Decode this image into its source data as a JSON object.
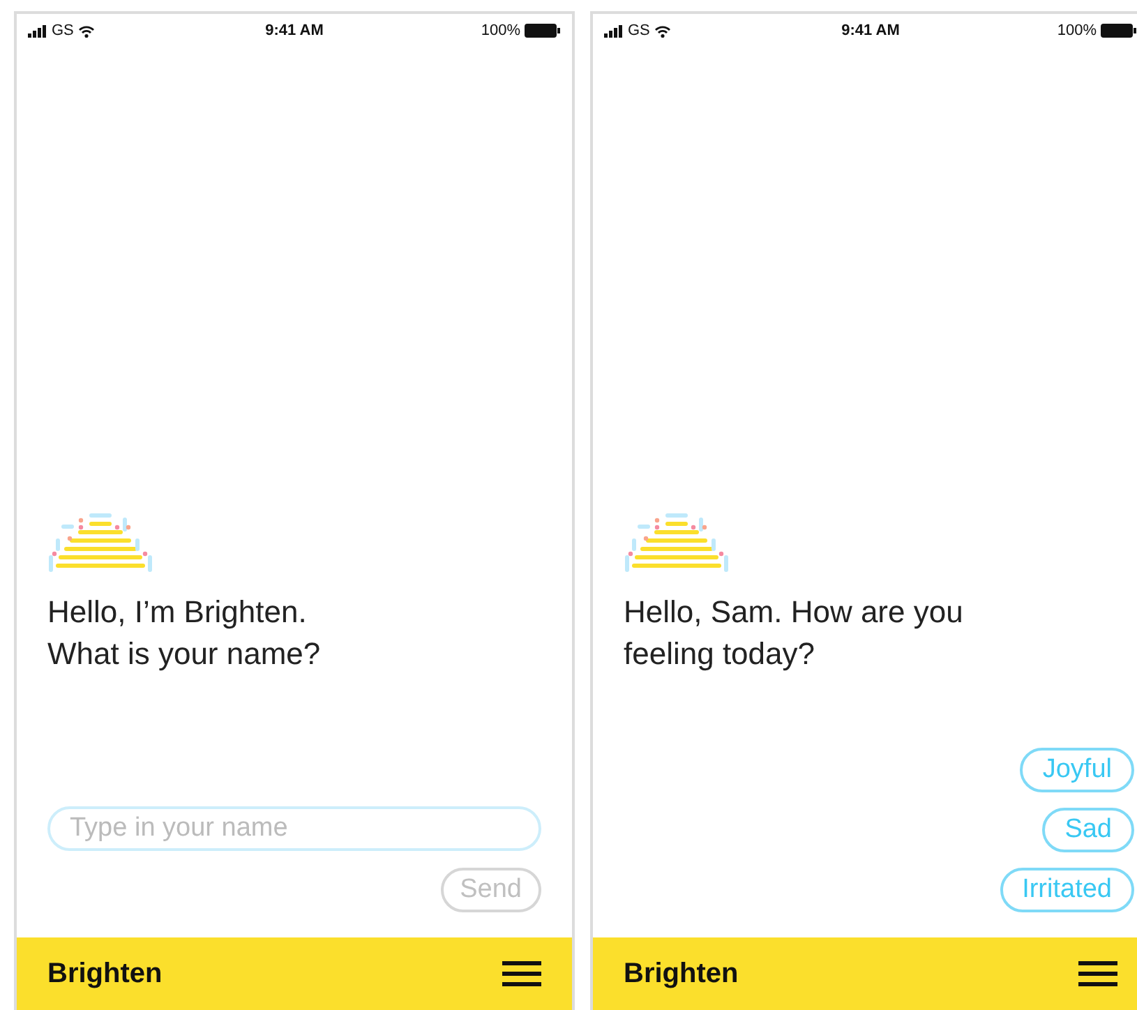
{
  "screens": [
    {
      "status_bar": {
        "carrier": "GS",
        "time": "9:41 AM",
        "battery": "100%"
      },
      "message": "Hello, I’m Brighten.\nWhat is your name?",
      "kind": "input",
      "input": {
        "placeholder": "Type in your name"
      },
      "send_button": {
        "label": "Send",
        "disabled": true
      },
      "footer": {
        "title": "Brighten"
      }
    },
    {
      "status_bar": {
        "carrier": "GS",
        "time": "9:41 AM",
        "battery": "100%"
      },
      "message": "Hello, Sam. How are you\nfeeling today?",
      "kind": "options",
      "options": [
        {
          "label": "Joyful",
          "selected": false
        },
        {
          "label": "Sad",
          "selected": false
        },
        {
          "label": "Irritated",
          "selected": false
        }
      ],
      "footer": {
        "title": "Brighten"
      }
    }
  ]
}
